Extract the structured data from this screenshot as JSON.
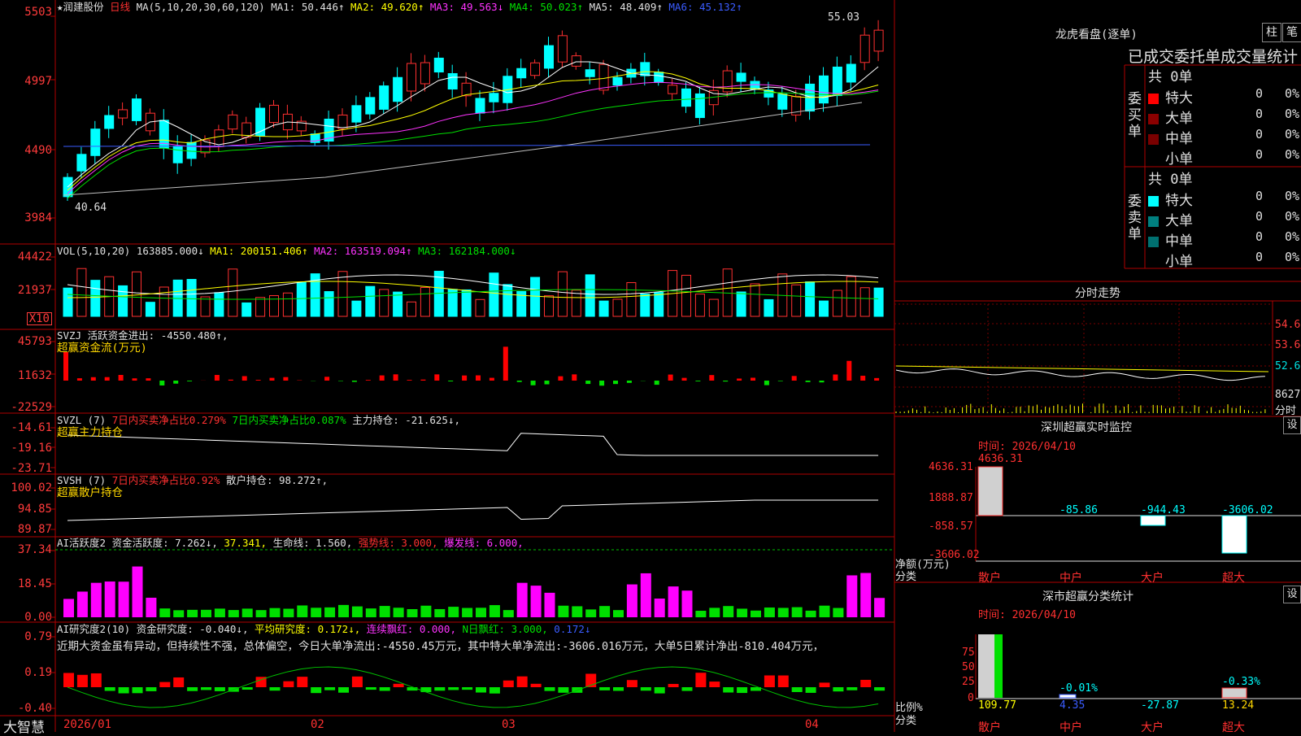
{
  "chart_data": {
    "type": "candlestick",
    "x_ticks": [
      "2026/01",
      "02",
      "03",
      "04"
    ],
    "price_ticks": [
      "5503",
      "4997",
      "4490",
      "3984"
    ],
    "price_high_label": "55.03",
    "price_low_label": "40.64",
    "volume_ticks": [
      "44422",
      "21937",
      "X10"
    ],
    "svzj_ticks": [
      "45793",
      "11632",
      "-22529"
    ],
    "svzl_ticks": [
      "-14.61",
      "-19.16",
      "-23.71"
    ],
    "svsh_ticks": [
      "100.02",
      "94.85",
      "89.87"
    ],
    "ai_ticks": [
      "37.34",
      "18.45",
      "0.00"
    ],
    "ai2_ticks": [
      "0.79",
      "0.19",
      "-0.40"
    ]
  },
  "header": {
    "stock": "★润建股份",
    "period": "日线",
    "ma_params": "MA(5,10,20,30,60,120)",
    "ma1": "MA1: 50.446↑",
    "ma2": "MA2: 49.620↑",
    "ma3": "MA3: 49.563↓",
    "ma4": "MA4: 50.023↑",
    "ma5": "MA5: 48.409↑",
    "ma6": "MA6: 45.132↑"
  },
  "vol_header": {
    "name": "VOL(5,10,20)",
    "v": "163885.000↓",
    "ma1": "MA1: 200151.406↑",
    "ma2": "MA2: 163519.094↑",
    "ma3": "MA3: 162184.000↓"
  },
  "svzj_header": {
    "name": "SVZJ",
    "active": "活跃资金进出: -4550.480↑,",
    "sub": "超赢资金流(万元)"
  },
  "svzl_header": {
    "name": "SVZL (7)",
    "a": "7日内买卖净占比0.279%",
    "b": "7日内买卖净占比0.087%",
    "c": "主力持仓: -21.625↓,",
    "sub": "超赢主力持仓"
  },
  "svsh_header": {
    "name": "SVSH (7)",
    "a": "7日内买卖净占比0.92%",
    "c": "散户持仓: 98.272↑,",
    "sub": "超赢散户持仓"
  },
  "ai_header": {
    "name": "AI活跃度2",
    "a": "资金活跃度: 7.262↓,",
    "b": "37.341,",
    "c": "生命线: 1.560,",
    "d": "强势线: 3.000,",
    "e": "爆发线: 6.000,"
  },
  "ai2_header": {
    "name": "AI研究度2(10)",
    "a": "资金研究度: -0.040↓,",
    "b": "平均研究度: 0.172↓,",
    "c": "连续飘红: 0.000,",
    "d": "N日飘红: 3.000,",
    "e": "0.172↓"
  },
  "comment": "近期大资金虽有异动，但持续性不强，总体偏空，今日大单净流出:-4550.45万元，其中特大单净流出:-3606.016万元，大单5日累计净出-810.404万元，",
  "brand": "大智慧",
  "right": {
    "lhb_title": "龙虎看盘(逐单)",
    "btn_bar": "柱",
    "btn_pen": "笔",
    "subtitle": "已成交委托单成交量统计",
    "buy_label": "委买单",
    "sell_label": "委卖单",
    "buy_total": "共 0单",
    "sell_total": "共 0单",
    "buy_rows": [
      {
        "label": "特大",
        "n": "0",
        "p": "0%",
        "color": "#ff0000"
      },
      {
        "label": "大单",
        "n": "0",
        "p": "0%",
        "color": "#8b0000"
      },
      {
        "label": "中单",
        "n": "0",
        "p": "0%",
        "color": "#7a0000"
      },
      {
        "label": "小单",
        "n": "0",
        "p": "0%",
        "color": "#000000"
      }
    ],
    "sell_rows": [
      {
        "label": "特大",
        "n": "0",
        "p": "0%",
        "color": "#00ffff"
      },
      {
        "label": "大单",
        "n": "0",
        "p": "0%",
        "color": "#007f7f"
      },
      {
        "label": "中单",
        "n": "0",
        "p": "0%",
        "color": "#007070"
      },
      {
        "label": "小单",
        "n": "0",
        "p": "0%",
        "color": "#000000"
      }
    ],
    "intraday_title": "分时走势",
    "intraday_ticks": [
      "54.60",
      "53.64",
      "52.68",
      "8627",
      "分时"
    ],
    "monitor_title": "深圳超赢实时监控",
    "monitor_set": "设",
    "monitor_time": "时间: 2026/04/10",
    "monitor_ticks": [
      "4636.31",
      "1888.87",
      "-858.57",
      "-3606.02"
    ],
    "monitor_values": [
      "4636.31",
      "-85.86",
      "-944.43",
      "-3606.02"
    ],
    "monitor_ylabel": "净额(万元)",
    "monitor_xlabel": "分类",
    "categories": [
      "散户",
      "中户",
      "大户",
      "超大"
    ],
    "stat_title": "深市超赢分类统计",
    "stat_set": "设",
    "stat_time": "时间: 2026/04/10",
    "stat_ticks": [
      "75",
      "50",
      "25",
      "0"
    ],
    "stat_top": [
      "-0.01%",
      "-0.33%"
    ],
    "stat_values": [
      "109.77",
      "4.35",
      "-27.87",
      "13.24"
    ],
    "stat_ylabel": "比例%",
    "stat_xlabel": "分类"
  }
}
